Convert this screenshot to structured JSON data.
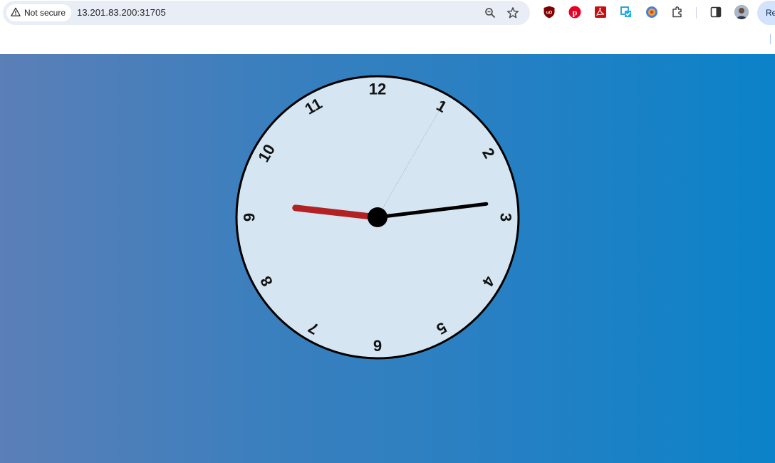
{
  "browser": {
    "security_label": "Not secure",
    "url": "13.201.83.200:31705",
    "relaunch_label": "Re",
    "icons": [
      "warning-icon",
      "zoom-icon",
      "star-icon",
      "ublock-icon",
      "pinterest-icon",
      "acrobat-icon",
      "screenshot-extension-icon",
      "colorful-extension-icon",
      "extensions-puzzle-icon",
      "side-panel-icon",
      "profile-avatar"
    ]
  },
  "clock": {
    "numerals": [
      "12",
      "1",
      "2",
      "3",
      "4",
      "5",
      "6",
      "7",
      "8",
      "9",
      "10",
      "11"
    ],
    "time": {
      "hours": 2,
      "minutes": 46,
      "seconds": 5
    },
    "colors": {
      "face": "#d6e5f2",
      "border": "#000000",
      "hour_hand": "#000000",
      "minute_hand": "#b22222",
      "second_hand": "#bbbbbb",
      "center": "#000000"
    }
  }
}
